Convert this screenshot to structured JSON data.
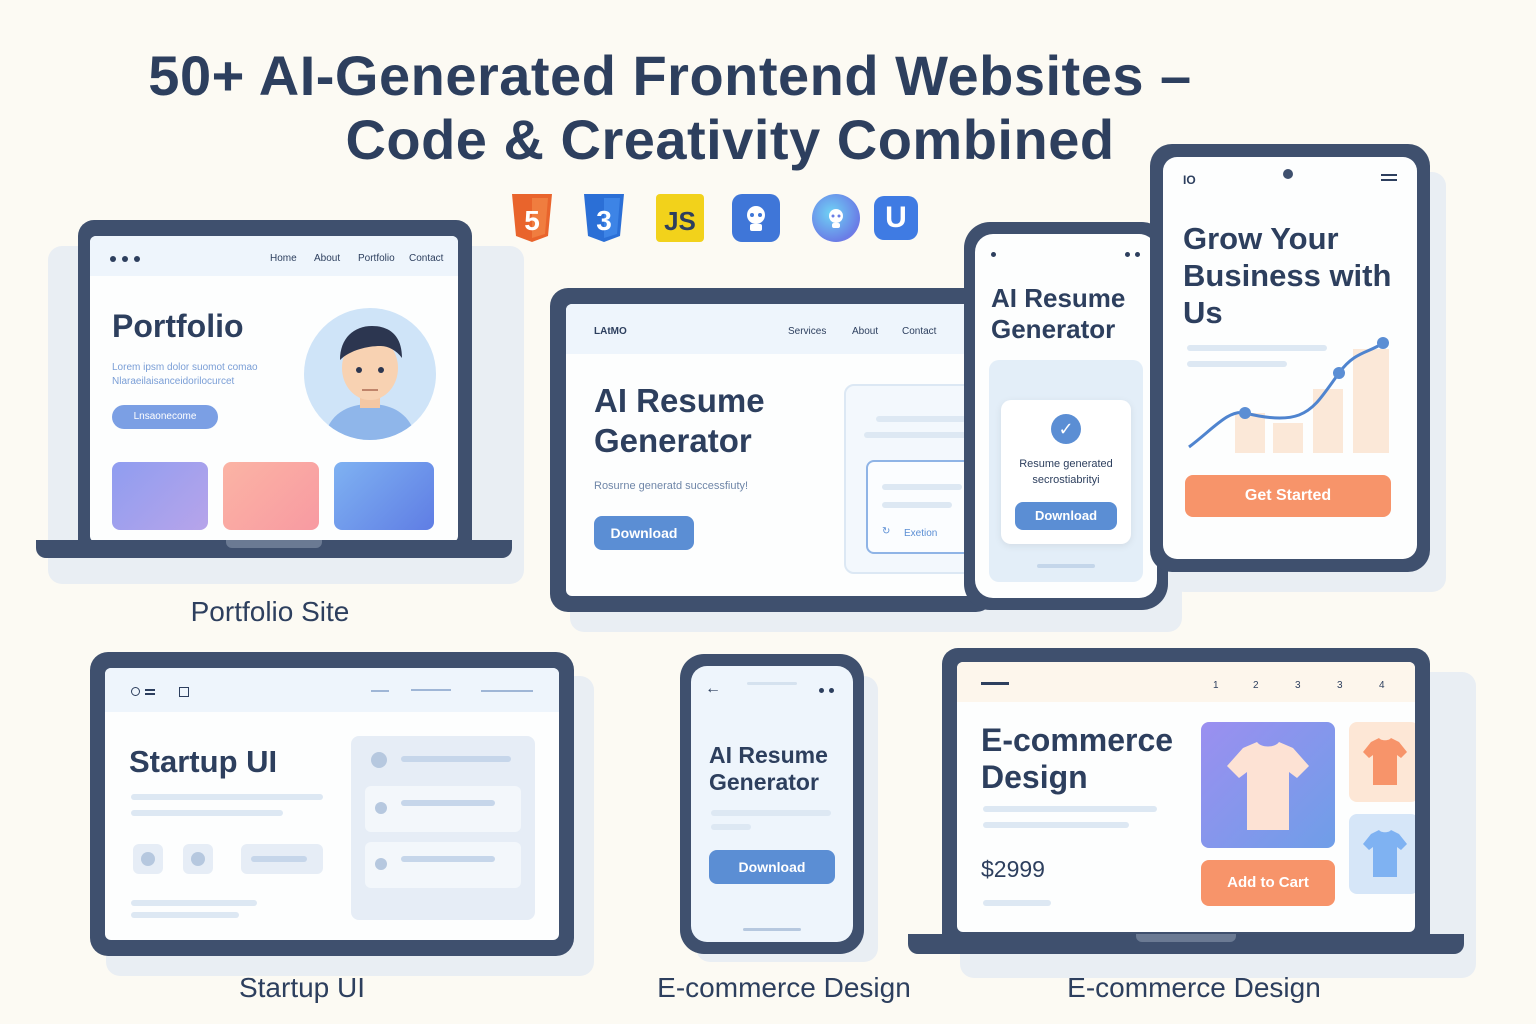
{
  "heading": {
    "line1": "50+ AI-Generated Frontend Websites –",
    "line2": "Code & Creativity Combined"
  },
  "tech_icons": [
    "html5-icon",
    "css3-icon",
    "js-icon",
    "robot-icon",
    "ai-bot-icon",
    "u-icon"
  ],
  "tech_icon_text": {
    "js": "JS",
    "u": "U",
    "five": "5",
    "three": "3"
  },
  "portfolio": {
    "nav": [
      "Home",
      "About",
      "Portfolio",
      "Contact"
    ],
    "title": "Portfolio",
    "lorem1": "Lorem ipsm dolor suomot comao",
    "lorem2": "Nlaraeilaisanceidorilocurcet",
    "button": "Lnsaonecome",
    "caption": "Portfolio Site"
  },
  "resume_tablet": {
    "logo": "LAtMO",
    "nav": [
      "Services",
      "About",
      "Contact"
    ],
    "title1": "AI Resume",
    "title2": "Generator",
    "subtitle": "Rosurne generatd successfiuty!",
    "button": "Download",
    "card_label": "Exetion"
  },
  "resume_phone": {
    "title1": "AI Resume",
    "title2": "Generator",
    "modal_text1": "Resume generated",
    "modal_text2": "secrostiabrityi",
    "button": "Download"
  },
  "business_tablet": {
    "logo": "IO",
    "title1": "Grow Your",
    "title2": "Business with",
    "title3": "Us",
    "button": "Get Started"
  },
  "startup": {
    "title": "Startup UI",
    "caption": "Startup UI"
  },
  "resume_phone2": {
    "title1": "AI Resume",
    "title2": "Generator",
    "button": "Download",
    "caption": "E-commerce Design"
  },
  "ecommerce": {
    "pages": [
      "1",
      "2",
      "3",
      "3",
      "4"
    ],
    "title1": "E-commerce",
    "title2": "Design",
    "price": "$2999",
    "button": "Add to Cart",
    "caption": "E-commerce Design"
  },
  "colors": {
    "navy": "#2d3f5e",
    "accent_blue": "#5b8ed4",
    "accent_orange": "#f7946a",
    "background": "#fcfaf3"
  }
}
